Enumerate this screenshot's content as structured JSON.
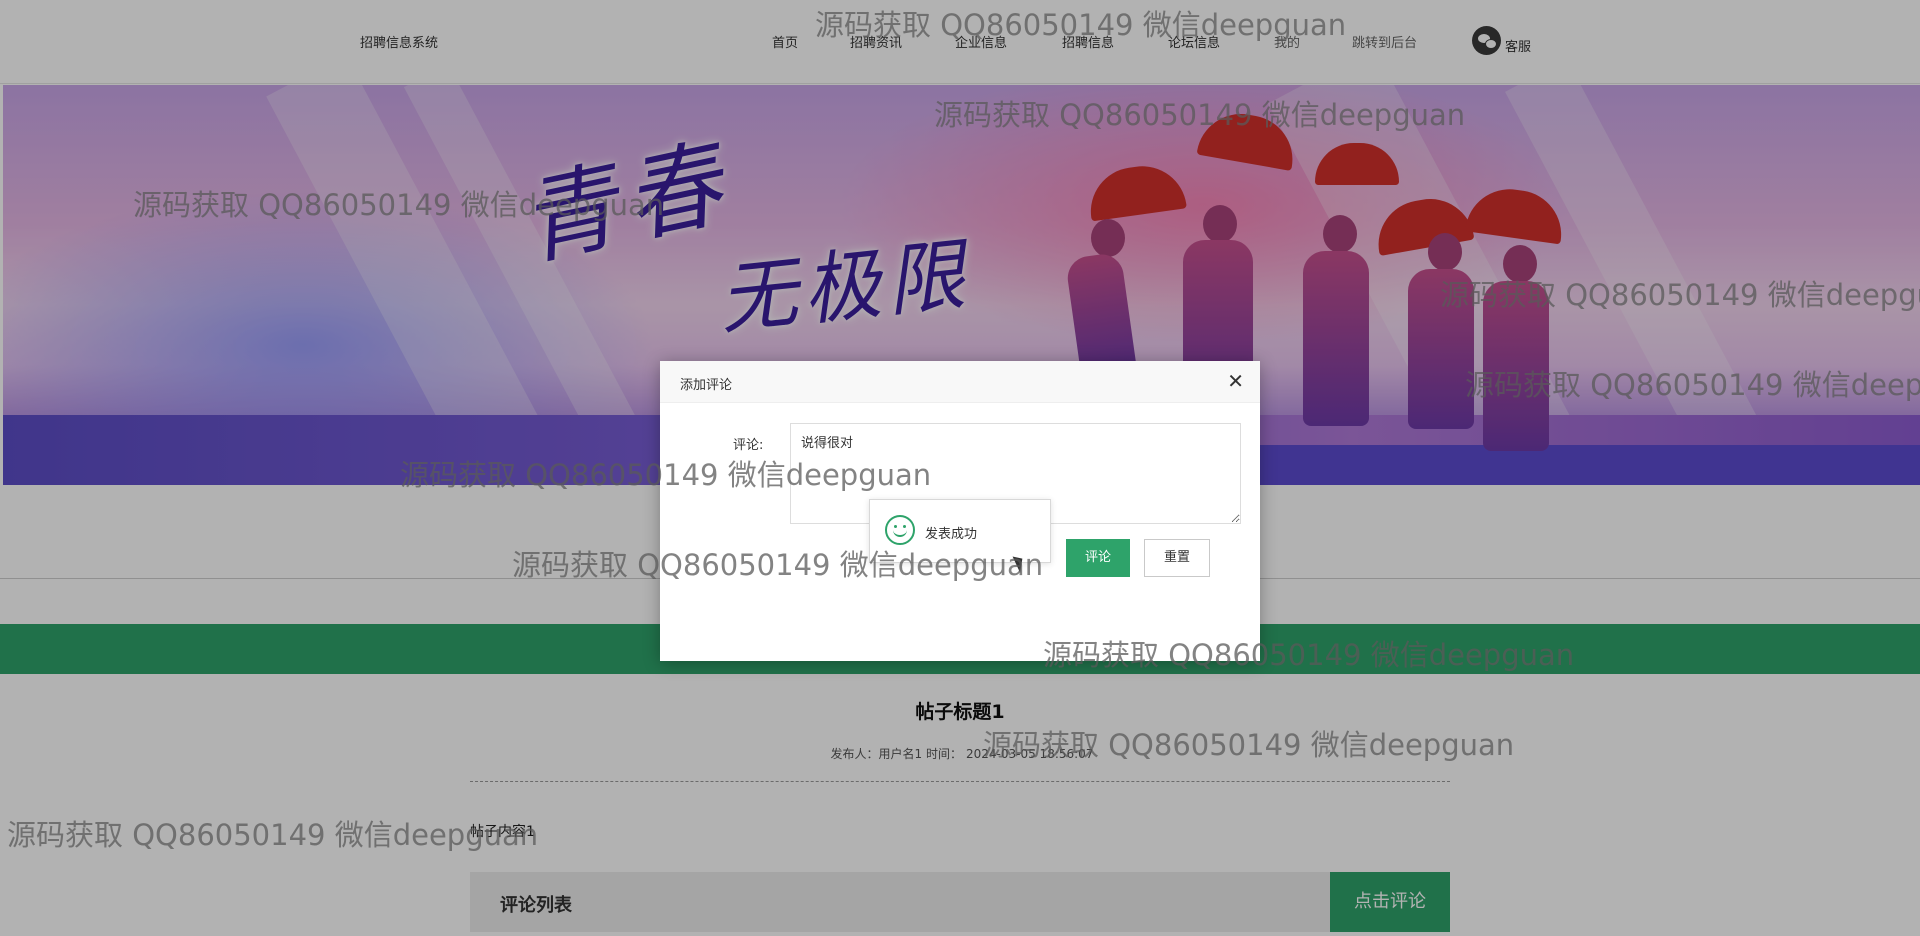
{
  "header": {
    "site_title": "招聘信息系统",
    "nav": {
      "home": "首页",
      "news": "招聘资讯",
      "company": "企业信息",
      "jobs": "招聘信息",
      "forum": "论坛信息",
      "mine": "我的",
      "admin": "跳转到后台"
    },
    "service_label": "客服"
  },
  "banner": {
    "slogan_line1": "青春",
    "slogan_line2": "无极限"
  },
  "post": {
    "title": "帖子标题1",
    "meta_prefix": "发布人：用户名1 时间：",
    "meta_time": "2024-03-05 18:56:07",
    "content": "帖子内容1"
  },
  "comments": {
    "section_title": "评论列表",
    "add_button": "点击评论"
  },
  "modal": {
    "title": "添加评论",
    "field_label": "评论:",
    "textarea_value": "说得很对",
    "submit_button": "评论",
    "reset_button": "重置",
    "toast_message": "发表成功"
  },
  "watermark": "源码获取 QQ86050149 微信deepguan",
  "colors": {
    "accent_green": "#2ea36a",
    "overlay": "rgba(0,0,0,0.3)"
  },
  "icons": {
    "service": "wechat-icon",
    "close": "close-icon",
    "toast": "smile-icon"
  }
}
